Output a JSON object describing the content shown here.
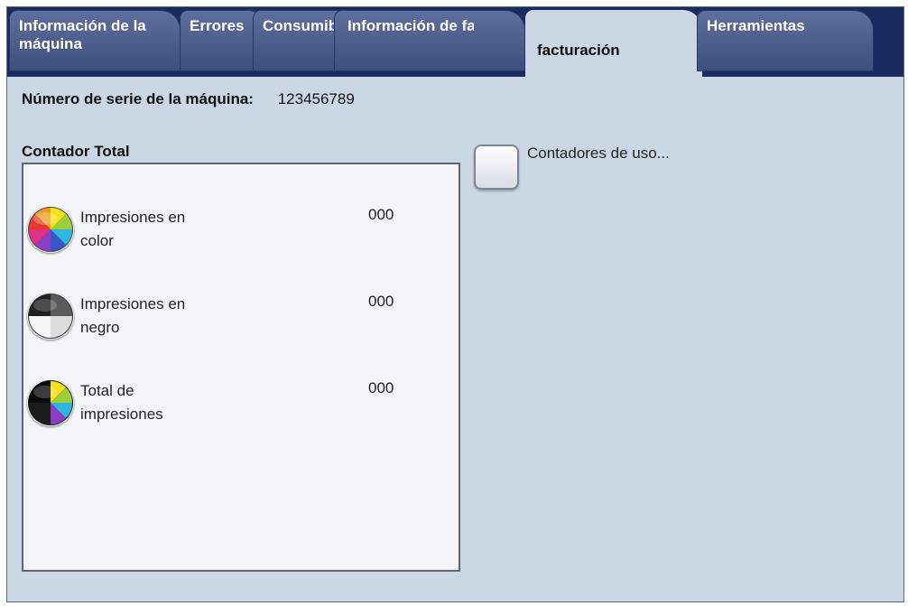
{
  "tabs": [
    {
      "label": "Información de la máquina",
      "active": false
    },
    {
      "label": "Errores",
      "active": false
    },
    {
      "label": "Consumibles",
      "active": false
    },
    {
      "label": "Información de facturación",
      "active": true
    },
    {
      "label": "Herramientas",
      "active": false
    }
  ],
  "machine": {
    "serial_label": "Número de serie de la máquina:",
    "serial_value": "123456789"
  },
  "counters": {
    "title": "Contador Total",
    "items": [
      {
        "label": "Impresiones en color",
        "value": "000",
        "icon": "color-impressions-icon"
      },
      {
        "label": "Impresiones en negro",
        "value": "000",
        "icon": "black-impressions-icon"
      },
      {
        "label": "Total de impresiones",
        "value": "000",
        "icon": "total-impressions-icon"
      }
    ]
  },
  "usage_counters": {
    "label": "Contadores de uso..."
  },
  "colors": {
    "tab_bar": "#1a2a5e",
    "tab": "#4e5f8e",
    "background": "#ccd7e6",
    "panel": "#f4f5f7"
  }
}
